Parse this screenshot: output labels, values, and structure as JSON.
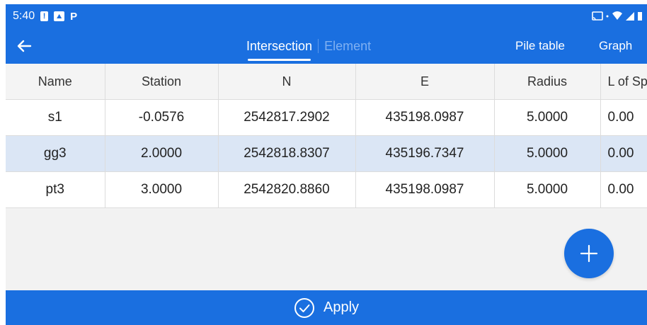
{
  "status_bar": {
    "time": "5:40",
    "icons": [
      "alert-icon",
      "image-icon",
      "p-icon",
      "cast-icon",
      "wifi-icon",
      "signal-icon",
      "battery-icon"
    ]
  },
  "app_bar": {
    "back_icon": "arrow-left-icon",
    "tabs": [
      {
        "label": "Intersection",
        "active": true
      },
      {
        "label": "Element",
        "active": false
      }
    ],
    "actions": {
      "pile_table": "Pile table",
      "graph": "Graph"
    }
  },
  "table": {
    "headers": [
      "Name",
      "Station",
      "N",
      "E",
      "Radius",
      "L of Sp"
    ],
    "rows": [
      {
        "name": "s1",
        "station": "-0.0576",
        "n": "2542817.2902",
        "e": "435198.0987",
        "radius": "5.0000",
        "l_of_sp": "0.00"
      },
      {
        "name": "gg3",
        "station": "2.0000",
        "n": "2542818.8307",
        "e": "435196.7347",
        "radius": "5.0000",
        "l_of_sp": "0.00"
      },
      {
        "name": "pt3",
        "station": "3.0000",
        "n": "2542820.8860",
        "e": "435198.0987",
        "radius": "5.0000",
        "l_of_sp": "0.00"
      }
    ]
  },
  "fab": {
    "icon": "plus-icon"
  },
  "apply": {
    "label": "Apply",
    "icon": "check-circle-icon"
  },
  "colors": {
    "primary": "#1a6fe0",
    "row_highlight": "#dbe6f5",
    "background": "#f2f2f2"
  }
}
